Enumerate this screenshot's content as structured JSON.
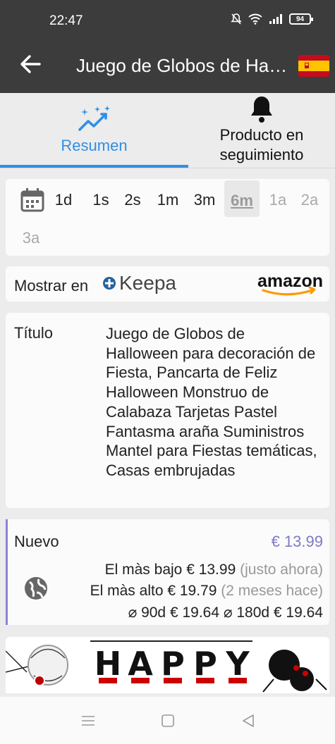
{
  "status_bar": {
    "time": "22:47",
    "battery": "94"
  },
  "app_bar": {
    "title": "Juego de Globos de Ha…",
    "flag": "spain-flag"
  },
  "tabs": [
    {
      "label": "Resumen",
      "icon": "sparkle-chart-icon",
      "selected": true
    },
    {
      "label": "Producto en seguimiento",
      "icon": "bell-icon",
      "selected": false
    }
  ],
  "ranges": [
    "1d",
    "1s",
    "2s",
    "1m",
    "3m",
    "6m",
    "1a",
    "2a",
    "3a"
  ],
  "ranges_state": {
    "selected": "6m",
    "disabled": [
      "1a",
      "2a",
      "3a"
    ]
  },
  "source": {
    "show_label": "Mostrar en",
    "keepa": "Keepa",
    "amazon": "amazon"
  },
  "product": {
    "title_label": "Título",
    "title_value": "Juego de Globos de Halloween para decoración de Fiesta, Pancarta de Feliz Halloween Monstruo de Calabaza Tarjetas Pastel Fantasma araña Suministros Mantel para Fiestas temáticas, Casas embrujadas"
  },
  "price": {
    "condition": "Nuevo",
    "current": "€ 13.99",
    "lowest_label": "El màs bajo",
    "lowest_value": "€ 13.99",
    "lowest_when": "(justo ahora)",
    "highest_label": "El màs alto",
    "highest_value": "€ 19.79",
    "highest_when": "(2 meses hace)",
    "avg90_label": "⌀ 90d",
    "avg90_value": "€ 19.64",
    "avg180_label": "⌀ 180d",
    "avg180_value": "€ 19.64"
  },
  "banner": {
    "letters": [
      "H",
      "A",
      "P",
      "P",
      "Y"
    ]
  },
  "colors": {
    "accent": "#2f8fe6",
    "header": "#3c3c3c",
    "price": "#7d7ac5"
  }
}
